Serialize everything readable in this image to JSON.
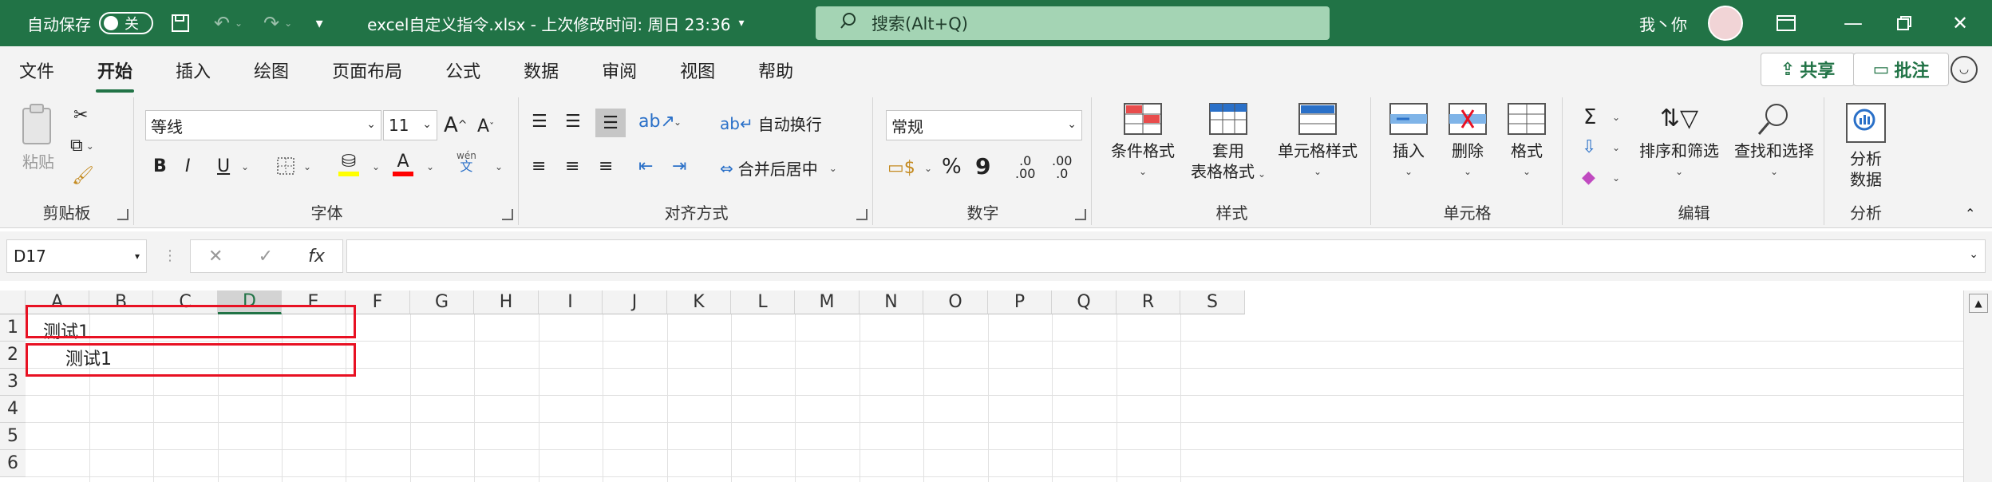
{
  "titlebar": {
    "autosave_label": "自动保存",
    "autosave_state": "关",
    "doc_title": "excel自定义指令.xlsx - 上次修改时间: 周日 23:36",
    "search_placeholder": "搜索(Alt+Q)",
    "user_name": "我丶你"
  },
  "menu": [
    "文件",
    "开始",
    "插入",
    "绘图",
    "页面布局",
    "公式",
    "数据",
    "审阅",
    "视图",
    "帮助"
  ],
  "menu_active": "开始",
  "share_label": "共享",
  "comment_label": "批注",
  "ribbon": {
    "clipboard": {
      "paste": "粘贴",
      "group": "剪贴板"
    },
    "font": {
      "font_name": "等线",
      "font_size": "11",
      "group": "字体",
      "bold": "B",
      "italic": "I",
      "underline": "U",
      "wen": "wén",
      "wen2": "文"
    },
    "alignment": {
      "wrap": "自动换行",
      "merge": "合并后居中",
      "group": "对齐方式"
    },
    "number": {
      "format": "常规",
      "percent": "%",
      "comma": "9",
      "inc": ".00",
      "dec": ".0",
      "group": "数字"
    },
    "styles": {
      "cond": "条件格式",
      "table1": "套用",
      "table2": "表格格式",
      "cell": "单元格样式",
      "group": "样式"
    },
    "cells": {
      "insert": "插入",
      "delete": "删除",
      "format": "格式",
      "group": "单元格"
    },
    "editing": {
      "sort": "排序和筛选",
      "find": "查找和选择",
      "group": "编辑"
    },
    "analysis": {
      "label1": "分析",
      "label2": "数据",
      "group": "分析"
    }
  },
  "formula": {
    "name_box": "D17",
    "fx": "fx",
    "value": ""
  },
  "columns": [
    "A",
    "B",
    "C",
    "D",
    "E",
    "F",
    "G",
    "H",
    "I",
    "J",
    "K",
    "L",
    "M",
    "N",
    "O",
    "P",
    "Q",
    "R",
    "S"
  ],
  "rows": [
    "1",
    "2",
    "3",
    "4",
    "5",
    "6"
  ],
  "cells": {
    "A1": "测试1",
    "A2": "测试1"
  },
  "colors": {
    "accent": "#217346",
    "highlight": "#e81123"
  }
}
